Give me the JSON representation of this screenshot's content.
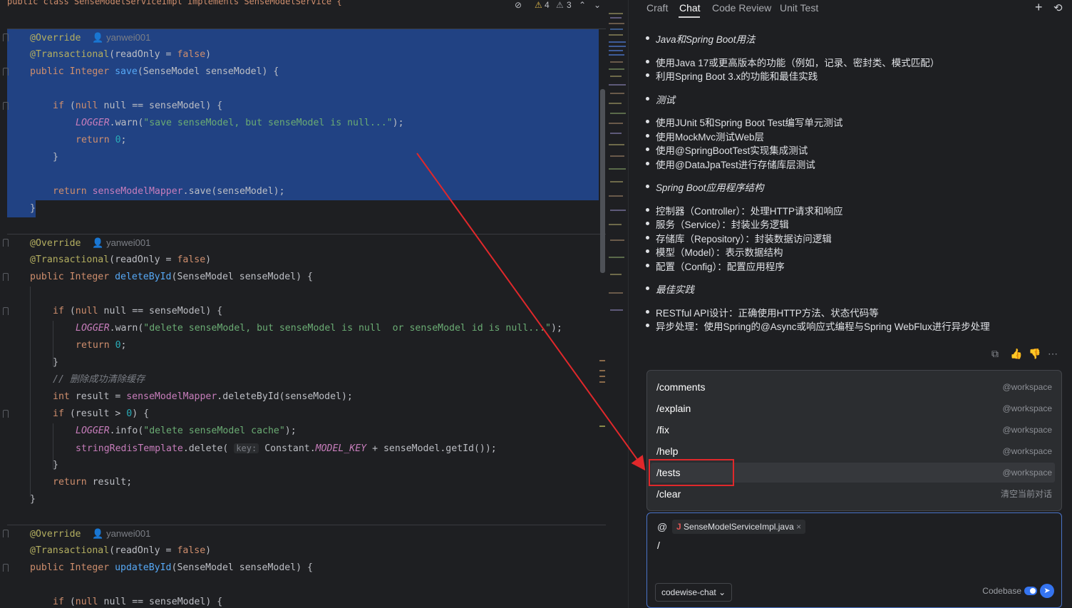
{
  "editor": {
    "header_code": "public class SenseModelServiceImpl implements SenseModelService {",
    "warnings": "4",
    "weak_warnings": "3",
    "author": "yanwei001",
    "save_method": {
      "annotation": "@Override",
      "tx": "@Transactional",
      "sig_type": "public Integer ",
      "sig_name": "save",
      "sig_params": "(SenseModel senseModel) {",
      "if_line": "null == senseModel) {",
      "logger": "LOGGER",
      "warn_msg": "\"save senseModel, but senseModel is null...\"",
      "ret_zero": "0",
      "mapper": "senseModelMapper",
      "save_call": ".save(senseModel);"
    },
    "delete_method": {
      "sig_name": "deleteById",
      "warn_msg": "\"delete senseModel, but senseModel is null  or senseModel id is null...\"",
      "comment": "// 删除成功清除缓存",
      "result_line": " result = ",
      "delete_call": ".deleteById(senseModel);",
      "if_result": "(result > ",
      "info_msg": "\"delete senseModel cache\"",
      "redis": "stringRedisTemplate",
      "hint": "key:",
      "const": "Constant.",
      "const_field": "MODEL_KEY",
      "getid": " + senseModel.getId());",
      "return_result": "result;"
    },
    "update_method": {
      "sig_name": "updateById"
    }
  },
  "panel": {
    "tabs": [
      "Craft",
      "Chat",
      "Code Review",
      "Unit Test"
    ],
    "messages": [
      {
        "text": "Java和Spring Boot用法",
        "italic": true
      },
      {
        "text": "使用Java 17或更高版本的功能（例如，记录、密封类、模式匹配）",
        "italic": false
      },
      {
        "text": "利用Spring Boot 3.x的功能和最佳实践",
        "italic": false
      },
      {
        "text": "测试",
        "italic": true
      },
      {
        "text": "使用JUnit 5和Spring Boot Test编写单元测试",
        "italic": false
      },
      {
        "text": "使用MockMvc测试Web层",
        "italic": false
      },
      {
        "text": "使用@SpringBootTest实现集成测试",
        "italic": false
      },
      {
        "text": "使用@DataJpaTest进行存储库层测试",
        "italic": false
      },
      {
        "text": "Spring Boot应用程序结构",
        "italic": true
      },
      {
        "text": "控制器（Controller）：处理HTTP请求和响应",
        "italic": false
      },
      {
        "text": "服务（Service）：封装业务逻辑",
        "italic": false
      },
      {
        "text": "存储库（Repository）：封装数据访问逻辑",
        "italic": false
      },
      {
        "text": "模型（Model）：表示数据结构",
        "italic": false
      },
      {
        "text": "配置（Config）：配置应用程序",
        "italic": false
      },
      {
        "text": "最佳实践",
        "italic": true
      },
      {
        "text": "RESTful API设计：正确使用HTTP方法、状态代码等",
        "italic": false
      },
      {
        "text": "异步处理：使用Spring的@Async或响应式编程与Spring WebFlux进行异步处理",
        "italic": false
      }
    ],
    "commands": [
      {
        "name": "/comments",
        "scope": "@workspace"
      },
      {
        "name": "/explain",
        "scope": "@workspace"
      },
      {
        "name": "/fix",
        "scope": "@workspace"
      },
      {
        "name": "/help",
        "scope": "@workspace"
      },
      {
        "name": "/tests",
        "scope": "@workspace"
      },
      {
        "name": "/clear",
        "scope": "清空当前对话"
      }
    ],
    "input": {
      "at": "@",
      "file_chip": "SenseModelServiceImpl.java",
      "typed": "/",
      "model": "codewise-chat",
      "codebase_label": "Codebase"
    }
  }
}
